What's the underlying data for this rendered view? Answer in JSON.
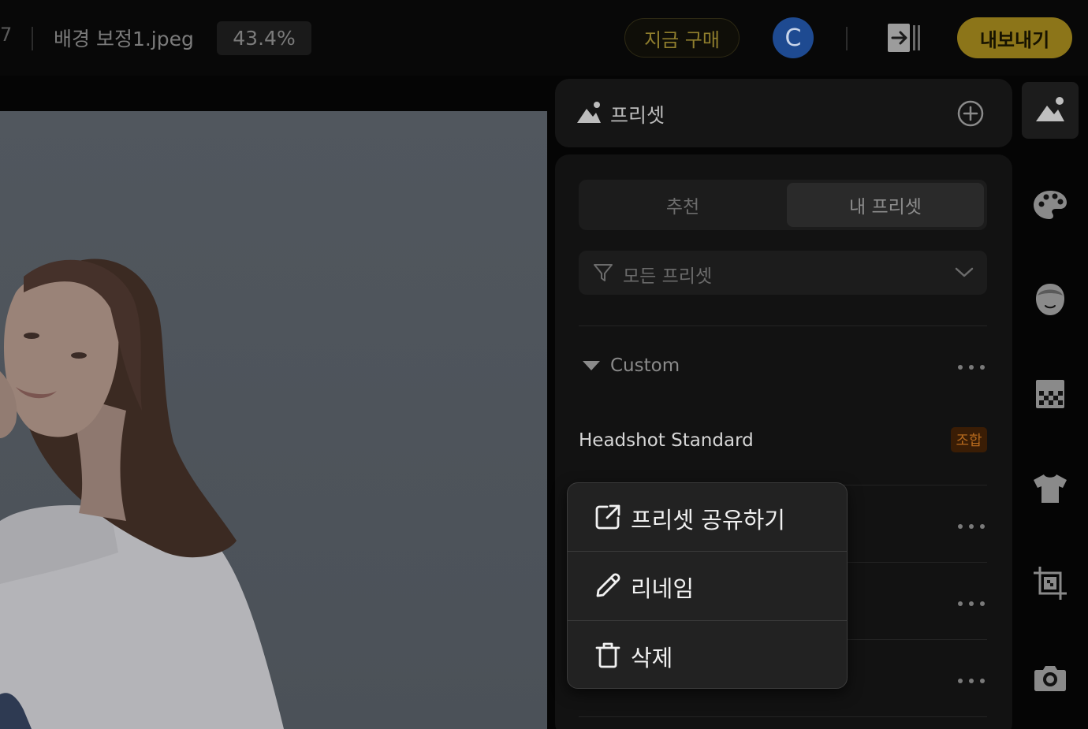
{
  "topbar": {
    "page_number": "7",
    "filename": "배경 보정1.jpeg",
    "zoom": "43.4%",
    "buy_label": "지금 구매",
    "avatar_letter": "C",
    "export_label": "내보내기"
  },
  "panel": {
    "title": "프리셋",
    "tabs": [
      {
        "label": "추천",
        "active": false
      },
      {
        "label": "내 프리셋",
        "active": true
      }
    ],
    "filter_label": "모든 프리셋",
    "group": {
      "label": "Custom",
      "expanded": true
    },
    "presets": [
      {
        "name": "Headshot Standard",
        "badge": "조합"
      }
    ]
  },
  "context_menu": {
    "items": [
      {
        "label": "프리셋 공유하기",
        "icon": "share-icon"
      },
      {
        "label": "리네임",
        "icon": "pencil-icon"
      },
      {
        "label": "삭제",
        "icon": "trash-icon"
      }
    ]
  },
  "rail": {
    "items": [
      {
        "icon": "preset-icon",
        "active": true
      },
      {
        "icon": "palette-icon",
        "active": false
      },
      {
        "icon": "face-icon",
        "active": false
      },
      {
        "icon": "background-icon",
        "active": false
      },
      {
        "icon": "shirt-icon",
        "active": false
      },
      {
        "icon": "crop-icon",
        "active": false
      },
      {
        "icon": "camera-icon",
        "active": false
      }
    ]
  },
  "colors": {
    "accent": "#e8c21d",
    "avatar": "#3b82f6",
    "badge_text": "#f0861c"
  }
}
